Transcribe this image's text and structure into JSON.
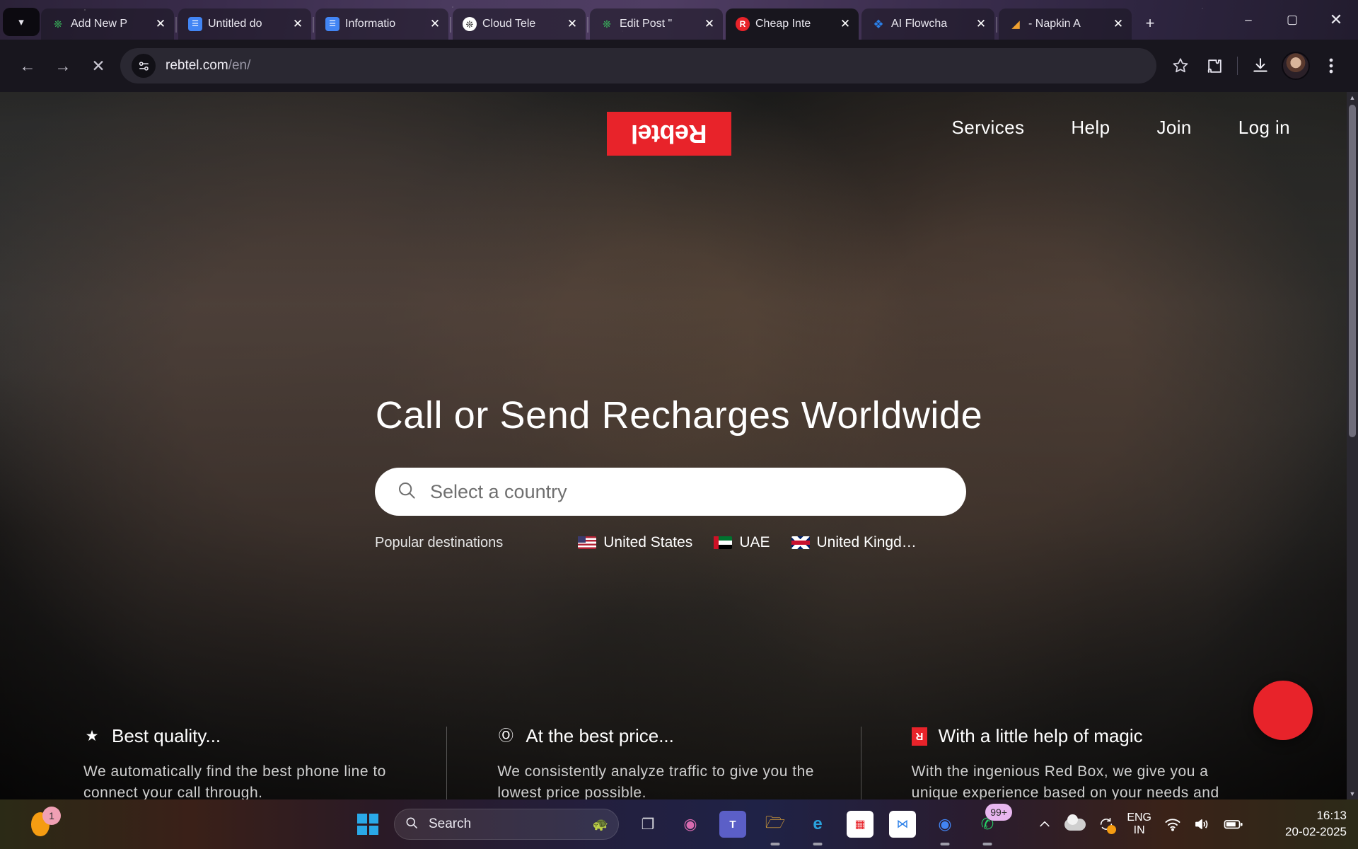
{
  "browser": {
    "tablist_toggle_icon": "chevron-down-icon",
    "tabs": [
      {
        "title": "Add New P",
        "favicon": "paw-icon",
        "active": false
      },
      {
        "title": "Untitled do",
        "favicon": "google-docs-icon",
        "active": false
      },
      {
        "title": "Informatio",
        "favicon": "google-docs-icon",
        "active": false
      },
      {
        "title": "Cloud Tele",
        "favicon": "openai-icon",
        "active": false
      },
      {
        "title": "Edit Post \"",
        "favicon": "paw-icon",
        "active": false
      },
      {
        "title": "Cheap Inte",
        "favicon": "rebtel-icon",
        "active": true
      },
      {
        "title": "AI Flowcha",
        "favicon": "spiral-icon",
        "active": false
      },
      {
        "title": "- Napkin A",
        "favicon": "napkin-icon",
        "active": false
      }
    ],
    "new_tab_label": "+",
    "window_controls": {
      "minimize": "–",
      "maximize": "▢",
      "close": "✕"
    },
    "toolbar": {
      "back_icon": "back-arrow-icon",
      "forward_icon": "forward-arrow-icon",
      "stop_icon": "stop-loading-icon",
      "site_info_icon": "site-settings-icon",
      "url_main": "rebtel.com",
      "url_path": "/en/",
      "bookmark_icon": "star-icon",
      "extensions_icon": "puzzle-icon",
      "downloads_icon": "download-icon",
      "profile_icon": "profile-avatar",
      "menu_icon": "three-dot-menu-icon"
    },
    "scrollbar": {
      "up_icon": "▲",
      "down_icon": "▼"
    }
  },
  "page": {
    "logo_text": "Rebtel",
    "logo_color": "#e8232a",
    "nav": [
      {
        "label": "Services"
      },
      {
        "label": "Help"
      },
      {
        "label": "Join"
      },
      {
        "label": "Log in"
      }
    ],
    "hero_title": "Call or Send Recharges Worldwide",
    "search": {
      "icon": "search-icon",
      "placeholder": "Select a country",
      "value": ""
    },
    "popular": {
      "label": "Popular destinations",
      "destinations": [
        {
          "name": "United States",
          "flag": "flag-us"
        },
        {
          "name": "UAE",
          "flag": "flag-ae"
        },
        {
          "name": "United Kingd…",
          "flag": "flag-gb"
        }
      ]
    },
    "features": [
      {
        "icon": "star-icon",
        "title": "Best quality...",
        "body": "We automatically find the best phone line to connect your call through."
      },
      {
        "icon": "dollar-coin-icon",
        "title": "At the best price...",
        "body": "We consistently analyze traffic to give you the lowest price possible."
      },
      {
        "icon": "red-box-icon",
        "title": "With a little help of magic",
        "body": "With the ingenious Red Box, we give you a unique experience based on your needs and calling behavior."
      }
    ],
    "scroll_hint_icon": "chevron-down-icon",
    "floating_action_icon": "record-button",
    "floating_action_color": "#e8232a"
  },
  "taskbar": {
    "copilot_badge": "1",
    "start_icon": "windows-logo-icon",
    "search": {
      "icon": "search-icon",
      "placeholder": "Search"
    },
    "pinned": [
      {
        "name": "task-view-icon",
        "glyph": "❐",
        "running": false
      },
      {
        "name": "copilot-icon",
        "glyph": "◍",
        "running": false
      },
      {
        "name": "microsoft-teams-icon",
        "glyph": "T",
        "running": false
      },
      {
        "name": "file-explorer-icon",
        "glyph": "🗀",
        "running": true
      },
      {
        "name": "microsoft-edge-icon",
        "glyph": "e",
        "running": true
      },
      {
        "name": "microsoft-store-icon",
        "glyph": "▤",
        "running": false
      },
      {
        "name": "app-icon",
        "glyph": "⧄",
        "running": false
      },
      {
        "name": "google-chrome-icon",
        "glyph": "◉",
        "running": true
      },
      {
        "name": "whatsapp-icon",
        "glyph": "✆",
        "running": true,
        "badge": "99+"
      }
    ],
    "tray": {
      "overflow_icon": "chevron-up-icon",
      "onedrive_icon": "cloud-icon",
      "sync_icon": "sync-icon",
      "language_line1": "ENG",
      "language_line2": "IN",
      "wifi_icon": "wifi-icon",
      "volume_icon": "speaker-icon",
      "battery_icon": "battery-icon",
      "time": "16:13",
      "date": "20-02-2025"
    }
  }
}
